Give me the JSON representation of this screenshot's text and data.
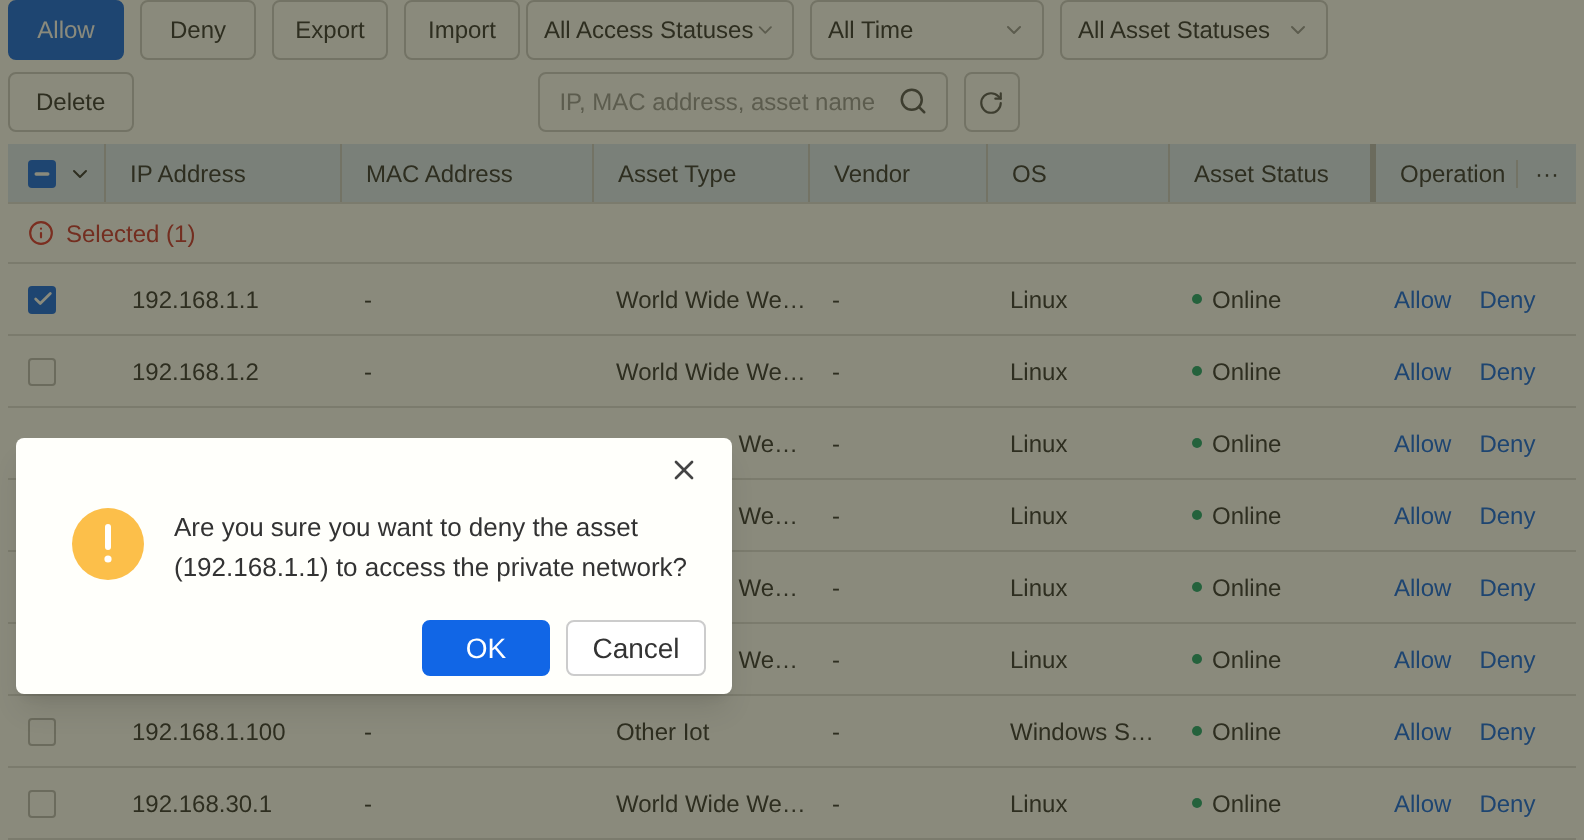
{
  "toolbar": {
    "buttons": [
      {
        "label": "Allow",
        "kind": "primary"
      },
      {
        "label": "Deny",
        "kind": "default"
      },
      {
        "label": "Export",
        "kind": "default"
      },
      {
        "label": "Import",
        "kind": "default"
      }
    ],
    "filters": [
      "All Access Statuses",
      "All Time",
      "All Asset Statuses"
    ],
    "delete_button": "Delete",
    "search": {
      "placeholder": "IP, MAC address, asset name"
    }
  },
  "table": {
    "header_checkbox": {
      "partial": true
    },
    "columns": [
      "IP Address",
      "MAC Address",
      "Asset Type",
      "Vendor",
      "OS",
      "Asset Status",
      "Operation"
    ],
    "more": "···",
    "selection_notice": "Selected (1)",
    "rows": [
      {
        "selected": true,
        "ip": "192.168.1.1",
        "mac": "-",
        "asset_type": "World Wide We…",
        "vendor": "-",
        "os": "Linux",
        "status": "Online",
        "actions": [
          "Allow",
          "Deny"
        ]
      },
      {
        "selected": false,
        "ip": "192.168.1.2",
        "mac": "-",
        "asset_type": "World Wide We…",
        "vendor": "-",
        "os": "Linux",
        "status": "Online",
        "actions": [
          "Allow",
          "Deny"
        ]
      },
      {
        "kind": "obscured",
        "asset_type": "We…",
        "vendor": "-",
        "os": "Linux",
        "status": "Online",
        "actions": [
          "Allow",
          "Deny"
        ]
      },
      {
        "kind": "obscured",
        "asset_type": "We…",
        "vendor": "-",
        "os": "Linux",
        "status": "Online",
        "actions": [
          "Allow",
          "Deny"
        ]
      },
      {
        "kind": "obscured",
        "asset_type": "We…",
        "vendor": "-",
        "os": "Linux",
        "status": "Online",
        "actions": [
          "Allow",
          "Deny"
        ]
      },
      {
        "kind": "obscured",
        "asset_type": "We…",
        "vendor": "-",
        "os": "Linux",
        "status": "Online",
        "actions": [
          "Allow",
          "Deny"
        ]
      },
      {
        "selected": false,
        "ip": "192.168.1.100",
        "mac": "-",
        "asset_type": "Other Iot",
        "vendor": "-",
        "os": "Windows S…",
        "status": "Online",
        "actions": [
          "Allow",
          "Deny"
        ]
      },
      {
        "selected": false,
        "ip": "192.168.30.1",
        "mac": "-",
        "asset_type": "World Wide We…",
        "vendor": "-",
        "os": "Linux",
        "status": "Online",
        "actions": [
          "Allow",
          "Deny"
        ]
      }
    ]
  },
  "dialog": {
    "message": "Are you sure you want to deny the asset (192.168.1.1) to access the private network?",
    "buttons": [
      {
        "label": "OK",
        "kind": "primary"
      },
      {
        "label": "Cancel",
        "kind": "default"
      }
    ]
  }
}
